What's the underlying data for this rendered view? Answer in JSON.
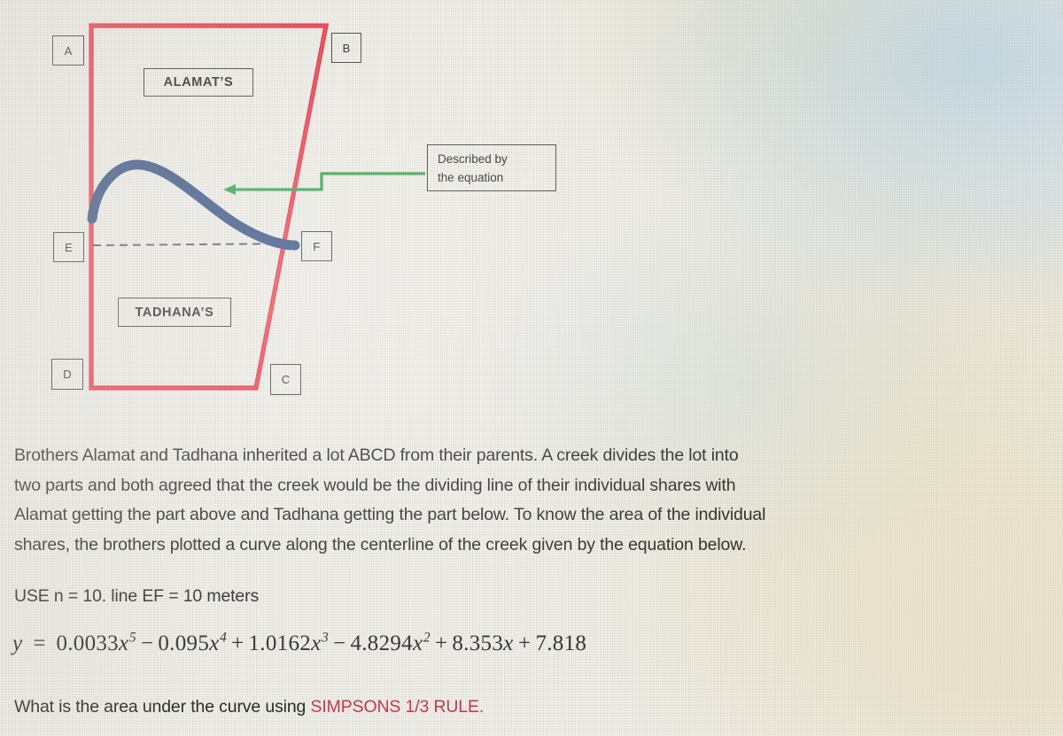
{
  "diagram": {
    "vertices": [
      {
        "key": "A",
        "label": "A"
      },
      {
        "key": "B",
        "label": "B"
      },
      {
        "key": "C",
        "label": "C"
      },
      {
        "key": "D",
        "label": "D"
      },
      {
        "key": "E",
        "label": "E"
      },
      {
        "key": "F",
        "label": "F"
      }
    ],
    "region_labels": [
      {
        "key": "alamat",
        "label": "ALAMAT’S"
      },
      {
        "key": "tadhana",
        "label": "TADHANA’S"
      }
    ],
    "callout": {
      "line1": "Described by",
      "line2": "the equation"
    },
    "colors": {
      "lot_outline": "#e02d3c",
      "creek_curve": "#2e4a7d",
      "annotation_arrow": "#2b9b46",
      "label_border": "#3b3b3b",
      "dashed_line": "#4a4a6a"
    }
  },
  "prose": {
    "line1": "Brothers Alamat and Tadhana inherited a lot ABCD from their parents. A creek divides the lot into",
    "line2": "two parts and both agreed that the creek would be the dividing line of their individual shares with",
    "line3": "Alamat getting the part above and Tadhana getting the part below. To know the area of the individual",
    "line4": "shares, the brothers plotted a curve along the centerline of the creek given by the equation below.",
    "usage": "USE n = 10. line EF = 10 meters"
  },
  "equation": {
    "lhs": "y",
    "equals": "=",
    "terms": [
      {
        "sign": "",
        "coefficient": "0.0033",
        "variable": "x",
        "exponent": "5"
      },
      {
        "sign": "−",
        "coefficient": "0.095",
        "variable": "x",
        "exponent": "4"
      },
      {
        "sign": "+",
        "coefficient": "1.0162",
        "variable": "x",
        "exponent": "3"
      },
      {
        "sign": "−",
        "coefficient": "4.8294",
        "variable": "x",
        "exponent": "2"
      },
      {
        "sign": "+",
        "coefficient": "8.353",
        "variable": "x",
        "exponent": ""
      },
      {
        "sign": "+",
        "coefficient": "7.818",
        "variable": "",
        "exponent": ""
      }
    ],
    "plain": "y = 0.0033x⁵ − 0.095x⁴ + 1.0162x³ − 4.8294x² + 8.353x + 7.818"
  },
  "question": {
    "lead": "What is the area under the curve using ",
    "accent": "SIMPSONS 1/3 RULE."
  }
}
